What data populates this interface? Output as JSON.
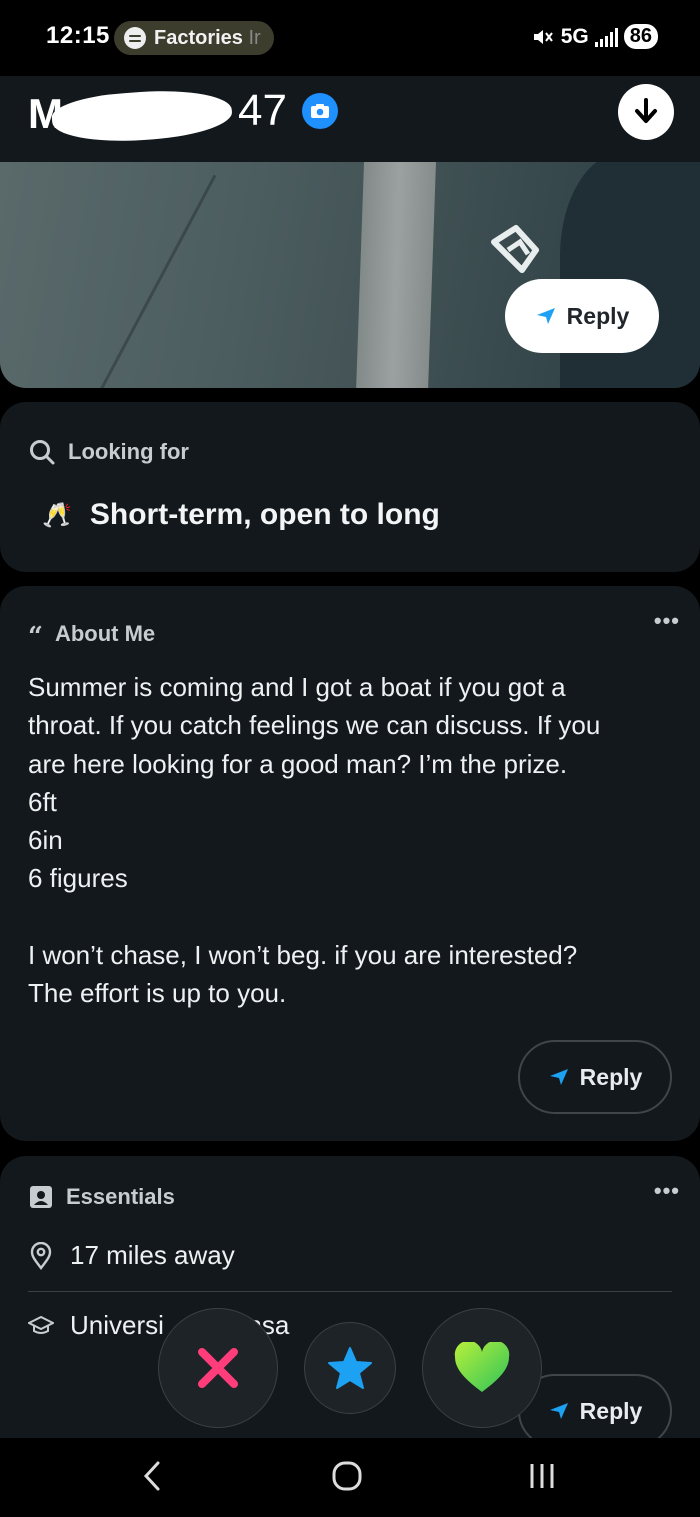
{
  "status_bar": {
    "time": "12:15",
    "media_app_icon": "spotify-icon",
    "media_text": "Factories",
    "media_text_fade": "Ir",
    "network": "5G",
    "battery": "86"
  },
  "profile": {
    "name_initial": "M",
    "age": "47",
    "verified_icon": "camera-icon",
    "download_icon": "arrow-down-icon"
  },
  "photo": {
    "reply_label": "Reply"
  },
  "looking_for": {
    "title": "Looking for",
    "emoji": "🥂",
    "value": "Short-term, open to long"
  },
  "about_me": {
    "title": "About Me",
    "more": "•••",
    "text": "Summer is coming and I got a boat if you got a\nthroat. If you catch feelings we can discuss. If you\nare here looking for a good man? I’m the prize.\n6ft\n6in\n6 figures\n\nI won’t chase, I won’t beg. if you are interested?\nThe effort is up to you.",
    "reply_label": "Reply"
  },
  "essentials": {
    "title": "Essentials",
    "more": "•••",
    "distance": "17 miles away",
    "school": "Universi",
    "school_tail": "kansa",
    "reply_label": "Reply"
  },
  "actions": {
    "nope_icon": "x-icon",
    "super_like_icon": "star-icon",
    "like_icon": "heart-icon"
  },
  "colors": {
    "accent_blue": "#1e90ff",
    "nope": "#ff3d7a",
    "super_like": "#1da1f2",
    "like": "#6fdc3c"
  }
}
